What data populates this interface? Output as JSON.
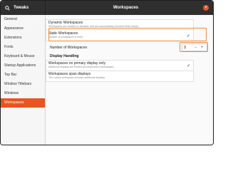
{
  "window": {
    "app_name": "Tweaks",
    "title": "Workspaces",
    "close_glyph": "×"
  },
  "sidebar": {
    "items": [
      {
        "label": "General"
      },
      {
        "label": "Appearance"
      },
      {
        "label": "Extensions"
      },
      {
        "label": "Fonts"
      },
      {
        "label": "Keyboard & Mouse"
      },
      {
        "label": "Startup Applications"
      },
      {
        "label": "Top Bar"
      },
      {
        "label": "Window Titlebars"
      },
      {
        "label": "Windows"
      },
      {
        "label": "Workspaces"
      }
    ],
    "active_index": 9
  },
  "workspaces": {
    "dynamic": {
      "title": "Dynamic Workspaces",
      "subtitle": "Workspaces are created on demand, and are automatically removed when empty."
    },
    "static": {
      "title": "Static Workspaces",
      "subtitle": "Number of workspaces is fixed.",
      "checked": true
    },
    "number_label": "Number of Workspaces",
    "number_value": "3",
    "minus": "−",
    "plus": "+"
  },
  "display_handling": {
    "heading": "Display Handling",
    "primary": {
      "title": "Workspaces on primary display only",
      "subtitle": "Additional displays are treated as independent workspaces.",
      "checked": true
    },
    "span": {
      "title": "Workspaces span displays",
      "subtitle": "The current workspace includes additional displays."
    }
  },
  "colors": {
    "accent": "#e95420",
    "highlight": "#f08a3a",
    "titlebar": "#2f2f2f"
  },
  "icons": [
    "search-icon",
    "close-icon",
    "check-icon"
  ]
}
